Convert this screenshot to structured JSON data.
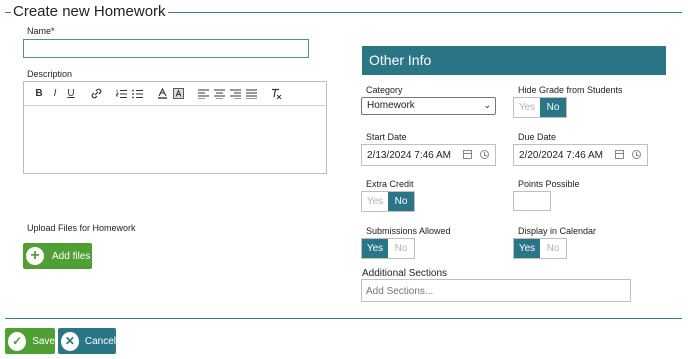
{
  "form": {
    "title": "Create new Homework",
    "name_label": "Name*",
    "name_value": "",
    "description_label": "Description",
    "upload_label": "Upload Files for Homework",
    "add_files_label": "Add files"
  },
  "editor": {
    "toolbar": [
      "B",
      "I",
      "U",
      "link",
      "ordered-list",
      "bullet-list",
      "font-color",
      "highlight",
      "align-left",
      "align-center",
      "align-right",
      "justify",
      "clear-format"
    ],
    "toolbar_glyphs": {
      "B": "B",
      "I": "I",
      "U": "U",
      "link": "⊘",
      "ordered": "≡",
      "bullet": "≡",
      "font_color": "A",
      "highlight": "A",
      "align_left": "≡",
      "align_center": "≡",
      "align_right": "≡",
      "justify": "≡",
      "clear": "Tx"
    }
  },
  "other_info": {
    "header": "Other Info",
    "category_label": "Category",
    "category_value": "Homework",
    "hide_grade_label": "Hide Grade from Students",
    "hide_grade": {
      "yes": "Yes",
      "no": "No",
      "selected": "No"
    },
    "start_date_label": "Start Date",
    "start_date_value": "2/13/2024 7:46 AM",
    "due_date_label": "Due Date",
    "due_date_value": "2/20/2024 7:46 AM",
    "extra_credit_label": "Extra Credit",
    "extra_credit": {
      "yes": "Yes",
      "no": "No",
      "selected": "No"
    },
    "points_label": "Points Possible",
    "points_value": "",
    "submissions_label": "Submissions Allowed",
    "submissions": {
      "yes": "Yes",
      "no": "No",
      "selected": "Yes"
    },
    "calendar_label": "Display in Calendar",
    "calendar": {
      "yes": "Yes",
      "no": "No",
      "selected": "Yes"
    },
    "sections_label": "Additional Sections",
    "sections_placeholder": "Add Sections..."
  },
  "actions": {
    "save_label": "Save",
    "cancel_label": "Cancel"
  },
  "colors": {
    "accent": "#2a7687",
    "success": "#4f9f34"
  }
}
